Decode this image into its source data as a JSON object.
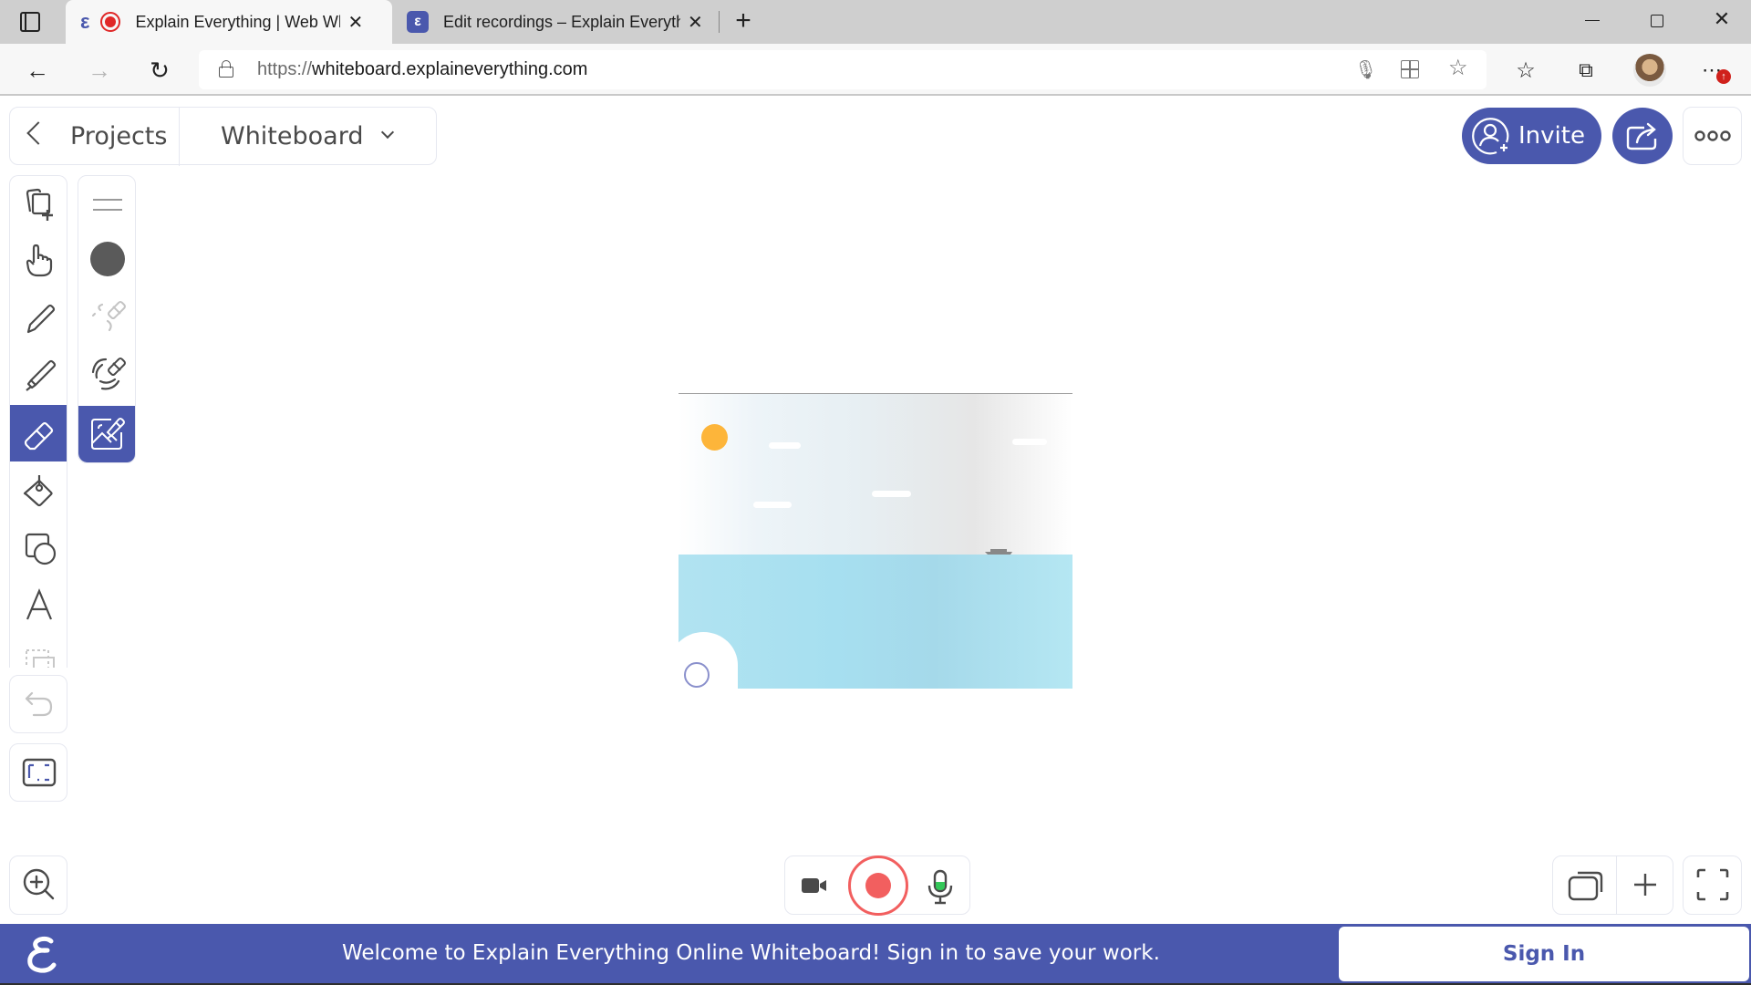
{
  "browser": {
    "tabs": [
      {
        "title": "Explain Everything | Web Whiteboard",
        "recording": true,
        "active": true
      },
      {
        "title": "Edit recordings – Explain Everything",
        "active": false
      }
    ],
    "url_scheme": "https://",
    "url_host": "whiteboard.explaineverything.com",
    "icons": [
      "sidebar-toggle-icon",
      "back-icon",
      "forward-icon",
      "refresh-icon",
      "lock-icon",
      "microphone-icon",
      "app-grid-icon",
      "add-favorite-icon",
      "favorites-icon",
      "collections-icon",
      "profile-avatar",
      "more-icon",
      "update-badge-icon"
    ],
    "window_controls": [
      "minimize",
      "restore",
      "close"
    ]
  },
  "app": {
    "header": {
      "back_label": "Projects",
      "project_title": "Whiteboard"
    },
    "actions": {
      "invite_label": "Invite"
    },
    "tools": [
      {
        "name": "add-slide",
        "selected": false
      },
      {
        "name": "hand",
        "selected": false
      },
      {
        "name": "pen",
        "selected": false
      },
      {
        "name": "highlighter",
        "selected": false
      },
      {
        "name": "eraser",
        "selected": true
      },
      {
        "name": "fill",
        "selected": false
      },
      {
        "name": "shapes",
        "selected": false
      },
      {
        "name": "text",
        "selected": false
      },
      {
        "name": "lasso",
        "selected": false
      }
    ],
    "eraser_options": [
      {
        "name": "size",
        "selected": false
      },
      {
        "name": "color",
        "selected": false
      },
      {
        "name": "erase-strokes",
        "selected": false,
        "disabled": true
      },
      {
        "name": "erase-area",
        "selected": false
      },
      {
        "name": "erase-image",
        "selected": true
      }
    ],
    "colors": {
      "accent": "#4a58ad",
      "record": "#f25f5f",
      "mic_level": "#34c759",
      "sun": "#fdb53a",
      "sea": "#a6dff0"
    },
    "record_controls": {
      "camera": "camera-icon",
      "record": "record-button",
      "mic": "microphone-icon"
    },
    "banner": {
      "message": "Welcome to Explain Everything Online Whiteboard! Sign in to save your work.",
      "sign_in_label": "Sign In"
    }
  }
}
